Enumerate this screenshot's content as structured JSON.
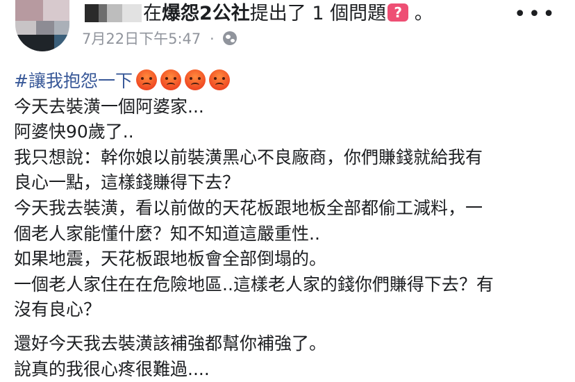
{
  "post": {
    "group_mid": "在",
    "group_name": "爆怨2公社",
    "action": "提出了 1 個問題",
    "question_icon": "?",
    "period": "。",
    "more_label": "•••",
    "timestamp": "7月22日下午5:47",
    "meta_sep": "·",
    "privacy_icon": "globe-icon"
  },
  "content": {
    "hashtag": "#讓我抱怨一下",
    "emoji": "angry-face-emoji",
    "emoji_count": 4,
    "lines": [
      "今天去裝潢一個阿婆家...",
      "阿婆快90歲了..",
      "我只想說：幹你娘以前裝潢黑心不良廠商，你們賺錢就給我有",
      "良心一點，這樣錢賺得下去？",
      "今天我去裝潢，看以前做的天花板跟地板全部都偷工減料，一",
      "個老人家能懂什麼？知不知道這嚴重性..",
      "如果地震，天花板跟地板會全部倒塌的。",
      "一個老人家住在在危險地區..這樣老人家的錢你們賺得下去？有",
      "沒有良心？"
    ],
    "lines2": [
      "還好今天我去裝潢該補強都幫你補強了。",
      "說真的我很心疼很難過...."
    ]
  },
  "colors": {
    "text": "#1c1e21",
    "meta": "#90949c",
    "hashtag": "#385898",
    "question_badge": "#ee4f74"
  }
}
